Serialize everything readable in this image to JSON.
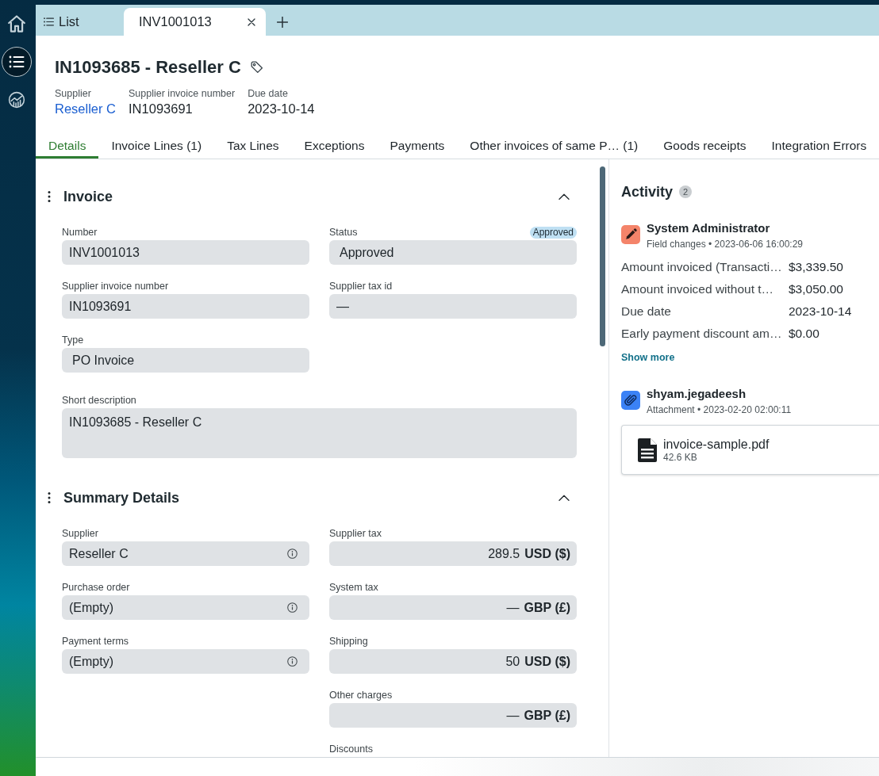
{
  "sidebar": {
    "items": [
      {
        "kind": "home",
        "selected": false
      },
      {
        "kind": "list",
        "selected": true
      },
      {
        "kind": "analytics",
        "selected": false
      }
    ]
  },
  "tab_strip": {
    "tabs": [
      {
        "kind": "list",
        "label": "List",
        "selected": false
      },
      {
        "kind": "record",
        "label": "INV1001013",
        "selected": true
      }
    ]
  },
  "header": {
    "title": "IN1093685 - Reseller C",
    "meta": [
      {
        "kind": "link",
        "label": "Supplier",
        "value": "Reseller C"
      },
      {
        "kind": "text",
        "label": "Supplier invoice number",
        "value": "IN1093691"
      },
      {
        "kind": "text",
        "label": "Due date",
        "value": "2023-10-14"
      }
    ]
  },
  "tabs": [
    {
      "label": "Details",
      "selected": true
    },
    {
      "label": "Invoice Lines (1)",
      "selected": false
    },
    {
      "label": "Tax Lines",
      "selected": false
    },
    {
      "label": "Exceptions",
      "selected": false
    },
    {
      "label": "Payments",
      "selected": false
    },
    {
      "label": "Other invoices of same P… (1)",
      "selected": false
    },
    {
      "label": "Goods receipts",
      "selected": false
    },
    {
      "label": "Integration Errors",
      "selected": false
    }
  ],
  "sections": [
    {
      "title": "Invoice",
      "expanded": true,
      "columns": [
        {
          "fields": [
            {
              "kind": "text",
              "label": "Number",
              "value": "INV1001013"
            },
            {
              "kind": "text",
              "label": "Supplier invoice number",
              "value": "IN1093691"
            },
            {
              "kind": "select",
              "label": "Type",
              "value": "PO Invoice"
            }
          ]
        },
        {
          "fields": [
            {
              "kind": "select",
              "label": "Status",
              "badge": "Approved",
              "value": "Approved"
            },
            {
              "kind": "text",
              "label": "Supplier tax id",
              "value": "—"
            }
          ]
        }
      ],
      "wide_fields": [
        {
          "kind": "textarea",
          "label": "Short description",
          "value": "IN1093685 - Reseller C"
        }
      ]
    },
    {
      "title": "Summary Details",
      "expanded": true,
      "columns": [
        {
          "fields": [
            {
              "kind": "lookup",
              "label": "Supplier",
              "value": "Reseller C"
            },
            {
              "kind": "lookup",
              "label": "Purchase order",
              "value": "(Empty)"
            },
            {
              "kind": "lookup",
              "label": "Payment terms",
              "value": "(Empty)"
            }
          ]
        },
        {
          "fields": [
            {
              "kind": "amount",
              "label": "Supplier tax",
              "value": "289.5",
              "currency": "USD ($)"
            },
            {
              "kind": "amount",
              "label": "System tax",
              "value": "—",
              "currency": "GBP (£)"
            },
            {
              "kind": "amount",
              "label": "Shipping",
              "value": "50",
              "currency": "USD ($)"
            },
            {
              "kind": "amount",
              "label": "Other charges",
              "value": "—",
              "currency": "GBP (£)"
            },
            {
              "kind": "amount",
              "label": "Discounts"
            }
          ]
        }
      ]
    }
  ],
  "activity": {
    "title": "Activity",
    "count": "2",
    "entries": [
      {
        "kind": "field_changes",
        "user": "System Administrator",
        "meta": "Field changes • 2023-06-06 16:00:29",
        "changes": [
          {
            "field": "Amount invoiced (Transacti…",
            "value": "$3,339.50"
          },
          {
            "field": "Amount invoiced without t…",
            "value": "$3,050.00"
          },
          {
            "field": "Due date",
            "value": "2023-10-14"
          },
          {
            "field": "Early payment discount am…",
            "value": "$0.00"
          }
        ],
        "link": "Show more"
      },
      {
        "kind": "attachment",
        "user": "shyam.jegadeesh",
        "meta": "Attachment • 2023-02-20 02:00:11",
        "file": {
          "name": "invoice-sample.pdf",
          "size": "42.6 KB"
        }
      }
    ]
  }
}
